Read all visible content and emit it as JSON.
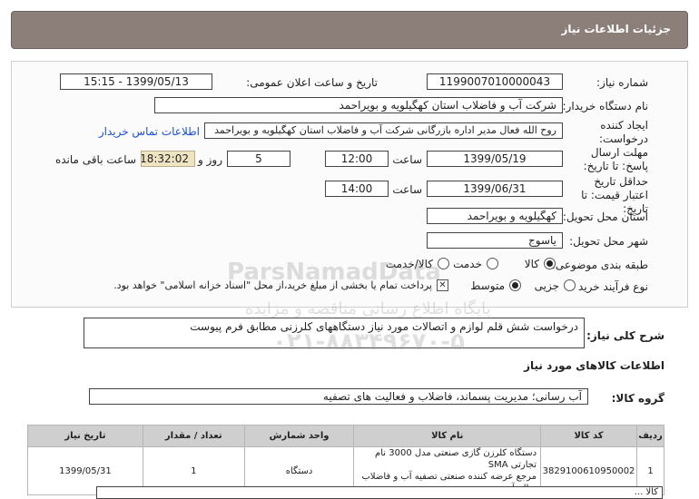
{
  "header": {
    "title": "جزئیات اطلاعات نیاز"
  },
  "fields": {
    "need_number_label": "شماره نیاز:",
    "need_number": "1199007010000043",
    "announce_label": "تاریخ و ساعت اعلان عمومی:",
    "announce_value": "1399/05/13 - 15:15",
    "buyer_label": "نام دستگاه خریدار:",
    "buyer_value": "شرکت آب و فاضلاب استان کهگیلویه و بویراحمد",
    "creator_label": "ایجاد کننده درخواست:",
    "creator_value": "روح الله فعال مدیر اداره بازرگانی شرکت آب و فاضلاب استان کهگیلویه و بویراحمد",
    "contact_link": "اطلاعات تماس خریدار",
    "deadline_label": "مهلت ارسال پاسخ: تا تاریخ:",
    "deadline_date": "1399/05/19",
    "time_label": "ساعت",
    "deadline_time": "12:00",
    "days_value": "5",
    "days_label": "روز و",
    "remaining_time": "18:32:02",
    "remaining_label": "ساعت باقی مانده",
    "validity_label": "حداقل تاریخ اعتبار قیمت: تا تاریخ:",
    "validity_date": "1399/06/31",
    "validity_time": "14:00",
    "province_label": "استان محل تحویل:",
    "province_value": "کهگیلویه و بویراحمد",
    "city_label": "شهر محل تحویل:",
    "city_value": "یاسوج",
    "category_label": "طبقه بندی موضوعی:",
    "category_options": [
      "کالا",
      "خدمت",
      "کالا/خدمت"
    ],
    "process_label": "نوع فرآیند خرید :",
    "process_options": [
      "جزیی",
      "متوسط"
    ],
    "payment_note": "پرداخت تمام یا بخشی از مبلغ خرید،از محل \"اسناد خزانه اسلامی\" خواهد بود."
  },
  "description": {
    "label": "شرح کلی نیاز:",
    "text": "درخواست شش قلم لوازم و اتصالات مورد نیاز دستگاههای کلرزنی مطابق فرم پیوست"
  },
  "goods_section": {
    "title": "اطلاعات کالاهای مورد نیاز",
    "group_label": "گروه کالا:",
    "group_value": "آب رسانی؛ مدیریت پسماند، فاضلاب و فعالیت های تصفیه"
  },
  "table": {
    "headers": [
      "ردیف",
      "کد کالا",
      "نام کالا",
      "واحد شمارش",
      "تعداد / مقدار",
      "تاریخ نیاز"
    ],
    "rows": [
      {
        "index": "1",
        "code": "3829100610950002",
        "name_line1": "دستگاه کلرزن گازی صنعتی مدل 3000 نام تجارتی SMA",
        "name_line2": "مرجع عرضه کننده صنعتی تصفیه آب و فاضلاب سالم آب",
        "unit": "دستگاه",
        "qty": "1",
        "date": "1399/05/31"
      }
    ]
  },
  "footer_note": "کالا ...",
  "watermark": {
    "line1": "ParsNamadData",
    "line2": "پایگاه اطلاع رسانی مناقصه و مزایده",
    "line3": "۰۲۱-۸۸۳۴۹۶۷۰-۵"
  }
}
